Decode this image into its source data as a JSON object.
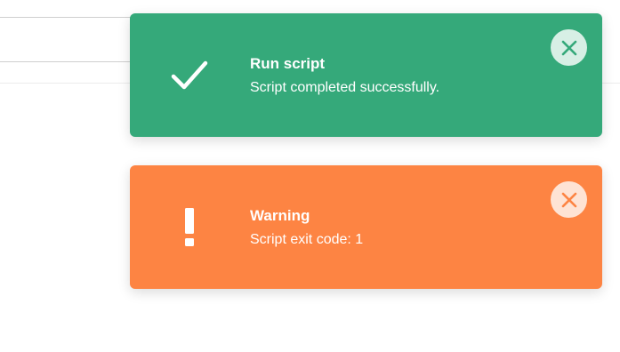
{
  "toasts": [
    {
      "type": "success",
      "title": "Run script",
      "message": "Script completed successfully.",
      "icon": "check-icon",
      "close_icon": "close-icon",
      "color": "#35a97a"
    },
    {
      "type": "warning",
      "title": "Warning",
      "message": "Script exit code: 1",
      "icon": "exclamation-icon",
      "close_icon": "close-icon",
      "color": "#fd8443"
    }
  ]
}
